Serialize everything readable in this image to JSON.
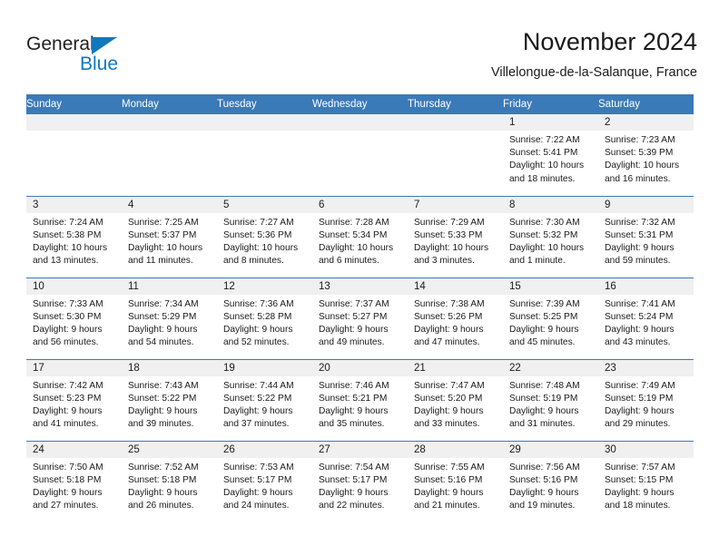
{
  "brand": {
    "name_top": "General",
    "name_bottom": "Blue",
    "accent_color": "#1277bc",
    "logo_icon": "triangle-icon"
  },
  "header": {
    "title": "November 2024",
    "subtitle": "Villelongue-de-la-Salanque, France"
  },
  "calendar": {
    "header_bg": "#3b7ab8",
    "daynum_bg": "#f0f0f0",
    "weekday_headers": [
      "Sunday",
      "Monday",
      "Tuesday",
      "Wednesday",
      "Thursday",
      "Friday",
      "Saturday"
    ],
    "weeks": [
      [
        {
          "day": "",
          "lines": []
        },
        {
          "day": "",
          "lines": []
        },
        {
          "day": "",
          "lines": []
        },
        {
          "day": "",
          "lines": []
        },
        {
          "day": "",
          "lines": []
        },
        {
          "day": "1",
          "lines": [
            "Sunrise: 7:22 AM",
            "Sunset: 5:41 PM",
            "Daylight: 10 hours",
            "and 18 minutes."
          ]
        },
        {
          "day": "2",
          "lines": [
            "Sunrise: 7:23 AM",
            "Sunset: 5:39 PM",
            "Daylight: 10 hours",
            "and 16 minutes."
          ]
        }
      ],
      [
        {
          "day": "3",
          "lines": [
            "Sunrise: 7:24 AM",
            "Sunset: 5:38 PM",
            "Daylight: 10 hours",
            "and 13 minutes."
          ]
        },
        {
          "day": "4",
          "lines": [
            "Sunrise: 7:25 AM",
            "Sunset: 5:37 PM",
            "Daylight: 10 hours",
            "and 11 minutes."
          ]
        },
        {
          "day": "5",
          "lines": [
            "Sunrise: 7:27 AM",
            "Sunset: 5:36 PM",
            "Daylight: 10 hours",
            "and 8 minutes."
          ]
        },
        {
          "day": "6",
          "lines": [
            "Sunrise: 7:28 AM",
            "Sunset: 5:34 PM",
            "Daylight: 10 hours",
            "and 6 minutes."
          ]
        },
        {
          "day": "7",
          "lines": [
            "Sunrise: 7:29 AM",
            "Sunset: 5:33 PM",
            "Daylight: 10 hours",
            "and 3 minutes."
          ]
        },
        {
          "day": "8",
          "lines": [
            "Sunrise: 7:30 AM",
            "Sunset: 5:32 PM",
            "Daylight: 10 hours",
            "and 1 minute."
          ]
        },
        {
          "day": "9",
          "lines": [
            "Sunrise: 7:32 AM",
            "Sunset: 5:31 PM",
            "Daylight: 9 hours",
            "and 59 minutes."
          ]
        }
      ],
      [
        {
          "day": "10",
          "lines": [
            "Sunrise: 7:33 AM",
            "Sunset: 5:30 PM",
            "Daylight: 9 hours",
            "and 56 minutes."
          ]
        },
        {
          "day": "11",
          "lines": [
            "Sunrise: 7:34 AM",
            "Sunset: 5:29 PM",
            "Daylight: 9 hours",
            "and 54 minutes."
          ]
        },
        {
          "day": "12",
          "lines": [
            "Sunrise: 7:36 AM",
            "Sunset: 5:28 PM",
            "Daylight: 9 hours",
            "and 52 minutes."
          ]
        },
        {
          "day": "13",
          "lines": [
            "Sunrise: 7:37 AM",
            "Sunset: 5:27 PM",
            "Daylight: 9 hours",
            "and 49 minutes."
          ]
        },
        {
          "day": "14",
          "lines": [
            "Sunrise: 7:38 AM",
            "Sunset: 5:26 PM",
            "Daylight: 9 hours",
            "and 47 minutes."
          ]
        },
        {
          "day": "15",
          "lines": [
            "Sunrise: 7:39 AM",
            "Sunset: 5:25 PM",
            "Daylight: 9 hours",
            "and 45 minutes."
          ]
        },
        {
          "day": "16",
          "lines": [
            "Sunrise: 7:41 AM",
            "Sunset: 5:24 PM",
            "Daylight: 9 hours",
            "and 43 minutes."
          ]
        }
      ],
      [
        {
          "day": "17",
          "lines": [
            "Sunrise: 7:42 AM",
            "Sunset: 5:23 PM",
            "Daylight: 9 hours",
            "and 41 minutes."
          ]
        },
        {
          "day": "18",
          "lines": [
            "Sunrise: 7:43 AM",
            "Sunset: 5:22 PM",
            "Daylight: 9 hours",
            "and 39 minutes."
          ]
        },
        {
          "day": "19",
          "lines": [
            "Sunrise: 7:44 AM",
            "Sunset: 5:22 PM",
            "Daylight: 9 hours",
            "and 37 minutes."
          ]
        },
        {
          "day": "20",
          "lines": [
            "Sunrise: 7:46 AM",
            "Sunset: 5:21 PM",
            "Daylight: 9 hours",
            "and 35 minutes."
          ]
        },
        {
          "day": "21",
          "lines": [
            "Sunrise: 7:47 AM",
            "Sunset: 5:20 PM",
            "Daylight: 9 hours",
            "and 33 minutes."
          ]
        },
        {
          "day": "22",
          "lines": [
            "Sunrise: 7:48 AM",
            "Sunset: 5:19 PM",
            "Daylight: 9 hours",
            "and 31 minutes."
          ]
        },
        {
          "day": "23",
          "lines": [
            "Sunrise: 7:49 AM",
            "Sunset: 5:19 PM",
            "Daylight: 9 hours",
            "and 29 minutes."
          ]
        }
      ],
      [
        {
          "day": "24",
          "lines": [
            "Sunrise: 7:50 AM",
            "Sunset: 5:18 PM",
            "Daylight: 9 hours",
            "and 27 minutes."
          ]
        },
        {
          "day": "25",
          "lines": [
            "Sunrise: 7:52 AM",
            "Sunset: 5:18 PM",
            "Daylight: 9 hours",
            "and 26 minutes."
          ]
        },
        {
          "day": "26",
          "lines": [
            "Sunrise: 7:53 AM",
            "Sunset: 5:17 PM",
            "Daylight: 9 hours",
            "and 24 minutes."
          ]
        },
        {
          "day": "27",
          "lines": [
            "Sunrise: 7:54 AM",
            "Sunset: 5:17 PM",
            "Daylight: 9 hours",
            "and 22 minutes."
          ]
        },
        {
          "day": "28",
          "lines": [
            "Sunrise: 7:55 AM",
            "Sunset: 5:16 PM",
            "Daylight: 9 hours",
            "and 21 minutes."
          ]
        },
        {
          "day": "29",
          "lines": [
            "Sunrise: 7:56 AM",
            "Sunset: 5:16 PM",
            "Daylight: 9 hours",
            "and 19 minutes."
          ]
        },
        {
          "day": "30",
          "lines": [
            "Sunrise: 7:57 AM",
            "Sunset: 5:15 PM",
            "Daylight: 9 hours",
            "and 18 minutes."
          ]
        }
      ]
    ]
  }
}
